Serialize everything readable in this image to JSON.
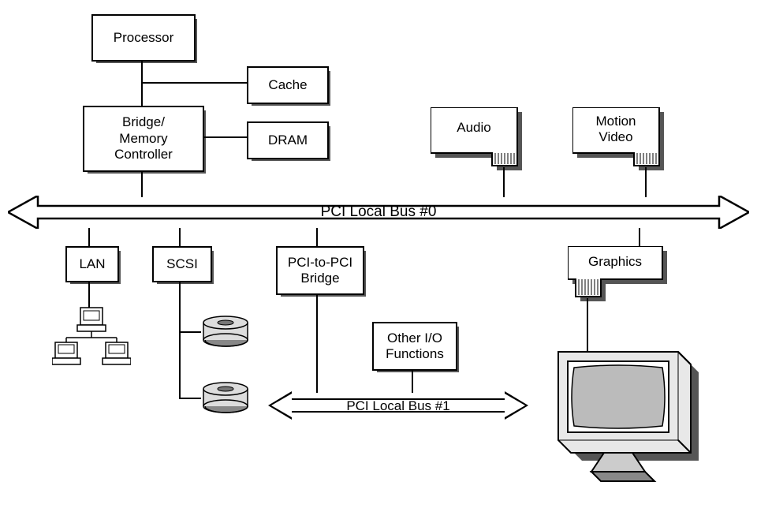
{
  "blocks": {
    "processor": "Processor",
    "cache": "Cache",
    "bridge_mem": "Bridge/\nMemory\nController",
    "dram": "DRAM",
    "audio": "Audio",
    "motion_video": "Motion\nVideo",
    "lan": "LAN",
    "scsi": "SCSI",
    "pci_pci_bridge": "PCI-to-PCI\nBridge",
    "other_io": "Other I/O\nFunctions",
    "graphics": "Graphics"
  },
  "buses": {
    "bus0": "PCI Local Bus #0",
    "bus1": "PCI Local Bus #1"
  }
}
